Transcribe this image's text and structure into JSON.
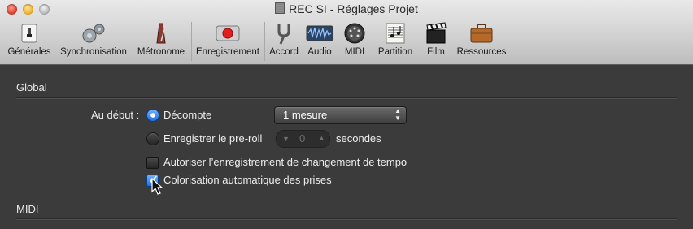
{
  "window": {
    "title": "REC SI - Réglages Projet"
  },
  "toolbar": {
    "items": [
      {
        "label": "Générales",
        "icon": "switch-icon"
      },
      {
        "label": "Synchronisation",
        "icon": "gears-icon"
      },
      {
        "label": "Métronome",
        "icon": "metronome-icon"
      },
      {
        "label": "Enregistrement",
        "icon": "record-icon"
      },
      {
        "label": "Accord",
        "icon": "tuning-fork-icon"
      },
      {
        "label": "Audio",
        "icon": "waveform-icon"
      },
      {
        "label": "MIDI",
        "icon": "midi-connector-icon"
      },
      {
        "label": "Partition",
        "icon": "score-icon"
      },
      {
        "label": "Film",
        "icon": "clapperboard-icon"
      },
      {
        "label": "Ressources",
        "icon": "briefcase-icon"
      }
    ]
  },
  "global": {
    "title": "Global",
    "au_debut_label": "Au début :",
    "decompte_label": "Décompte",
    "decompte_selected": true,
    "mesure_value": "1 mesure",
    "preroll_label": "Enregistrer le pre-roll",
    "preroll_selected": false,
    "preroll_value": "0",
    "secondes_label": "secondes",
    "tempo_label": "Autoriser l’enregistrement de changement de tempo",
    "tempo_checked": false,
    "color_label": "Colorisation automatique des prises",
    "color_checked": true
  },
  "midi": {
    "title": "MIDI"
  },
  "colors": {
    "accent": "#2f80ed",
    "record": "#e02020"
  }
}
